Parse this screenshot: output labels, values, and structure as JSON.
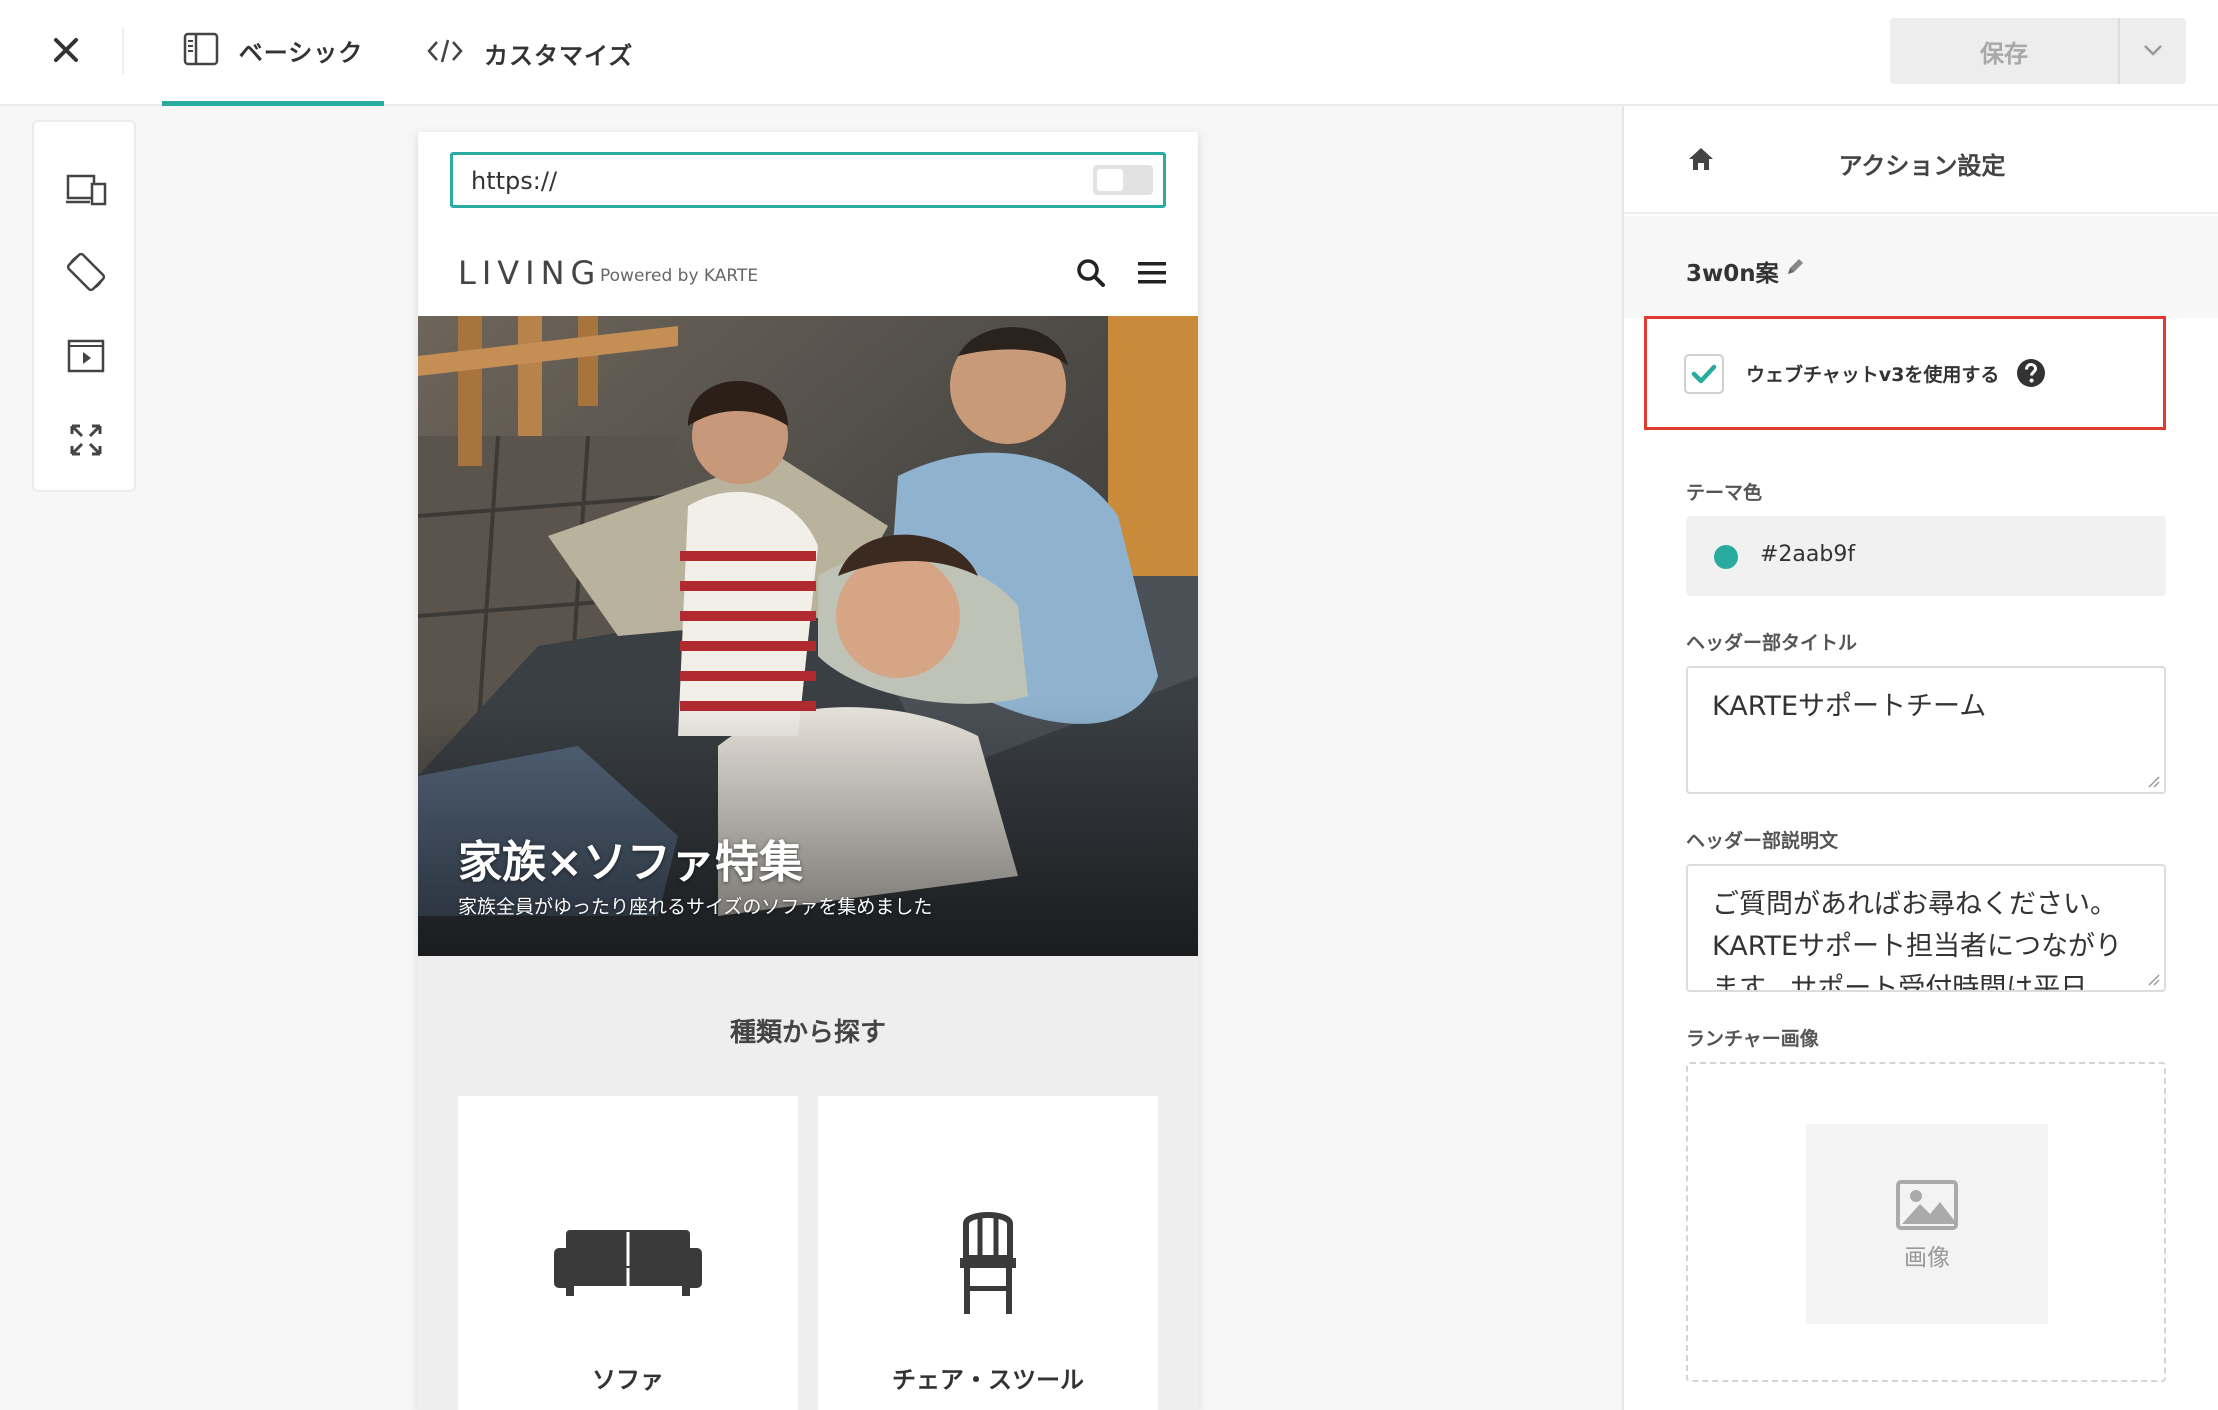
{
  "toolbar": {
    "tab_basic": "ベーシック",
    "tab_custom": "カスタマイズ",
    "save_label": "保存"
  },
  "preview": {
    "url": "https://",
    "logo": "LIVING",
    "powered_by": "Powered by KARTE",
    "hero_title": "家族×ソファ特集",
    "hero_subtitle": "家族全員がゆったり座れるサイズのソファを集めました",
    "section_title": "種類から探す",
    "categories": [
      {
        "label": "ソファ",
        "icon": "sofa-icon"
      },
      {
        "label": "チェア・スツール",
        "icon": "chair-icon"
      }
    ]
  },
  "panel": {
    "title": "アクション設定",
    "variant_name": "3w0n案",
    "webchat_v3_label": "ウェブチャットv3を使用する",
    "webchat_v3_checked": true,
    "theme_color_label": "テーマ色",
    "theme_color_value": "#2aab9f",
    "header_title_label": "ヘッダー部タイトル",
    "header_title_value": "KARTEサポートチーム",
    "header_desc_label": "ヘッダー部説明文",
    "header_desc_value": "ご質問があればお尋ねください。KARTEサポート担当者につながります。サポート受付時間は平日",
    "launcher_image_label": "ランチャー画像",
    "image_placeholder_label": "画像"
  },
  "colors": {
    "accent": "#2aab9f",
    "highlight_box": "#e03b2f"
  }
}
